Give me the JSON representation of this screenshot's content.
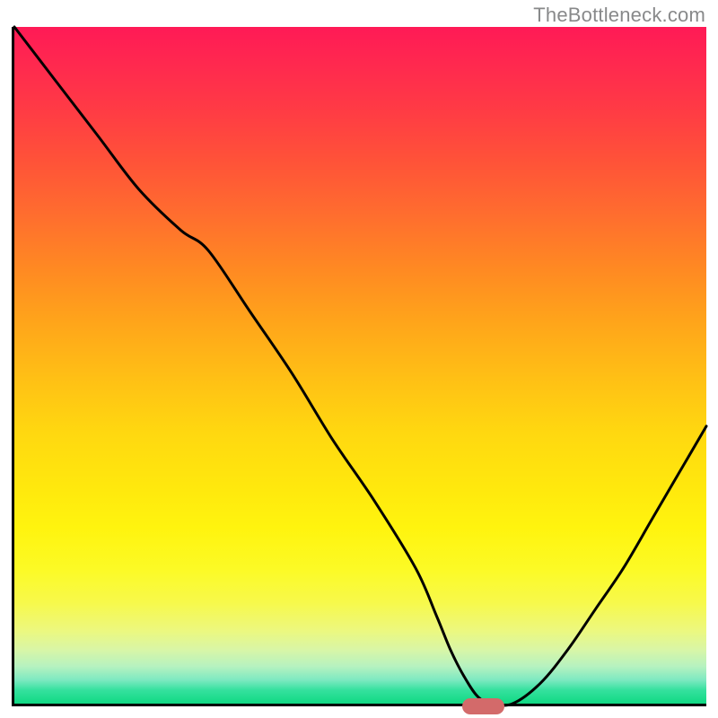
{
  "watermark": {
    "text": "TheBottleneck.com"
  },
  "colors": {
    "gradient_top": "#ff1a56",
    "gradient_mid": "#ffe80d",
    "gradient_bottom": "#10d983",
    "curve": "#000000",
    "marker": "#d36a6a",
    "axis": "#000000"
  },
  "chart_data": {
    "type": "line",
    "title": "",
    "xlabel": "",
    "ylabel": "",
    "xlim": [
      0,
      100
    ],
    "ylim": [
      0,
      100
    ],
    "grid": false,
    "legend": false,
    "series": [
      {
        "name": "curve",
        "x": [
          0,
          6,
          12,
          18,
          24,
          28,
          34,
          40,
          46,
          52,
          58,
          61,
          63,
          65,
          67,
          69,
          72,
          76,
          80,
          84,
          88,
          92,
          96,
          100
        ],
        "values": [
          100,
          92,
          84,
          76,
          70,
          67,
          58,
          49,
          39,
          30,
          20,
          13,
          8,
          4,
          1,
          0,
          0,
          3,
          8,
          14,
          20,
          27,
          34,
          41
        ]
      }
    ],
    "marker": {
      "x": 67.5,
      "y": 0,
      "width_pct": 6,
      "height_pct": 2.4
    }
  }
}
